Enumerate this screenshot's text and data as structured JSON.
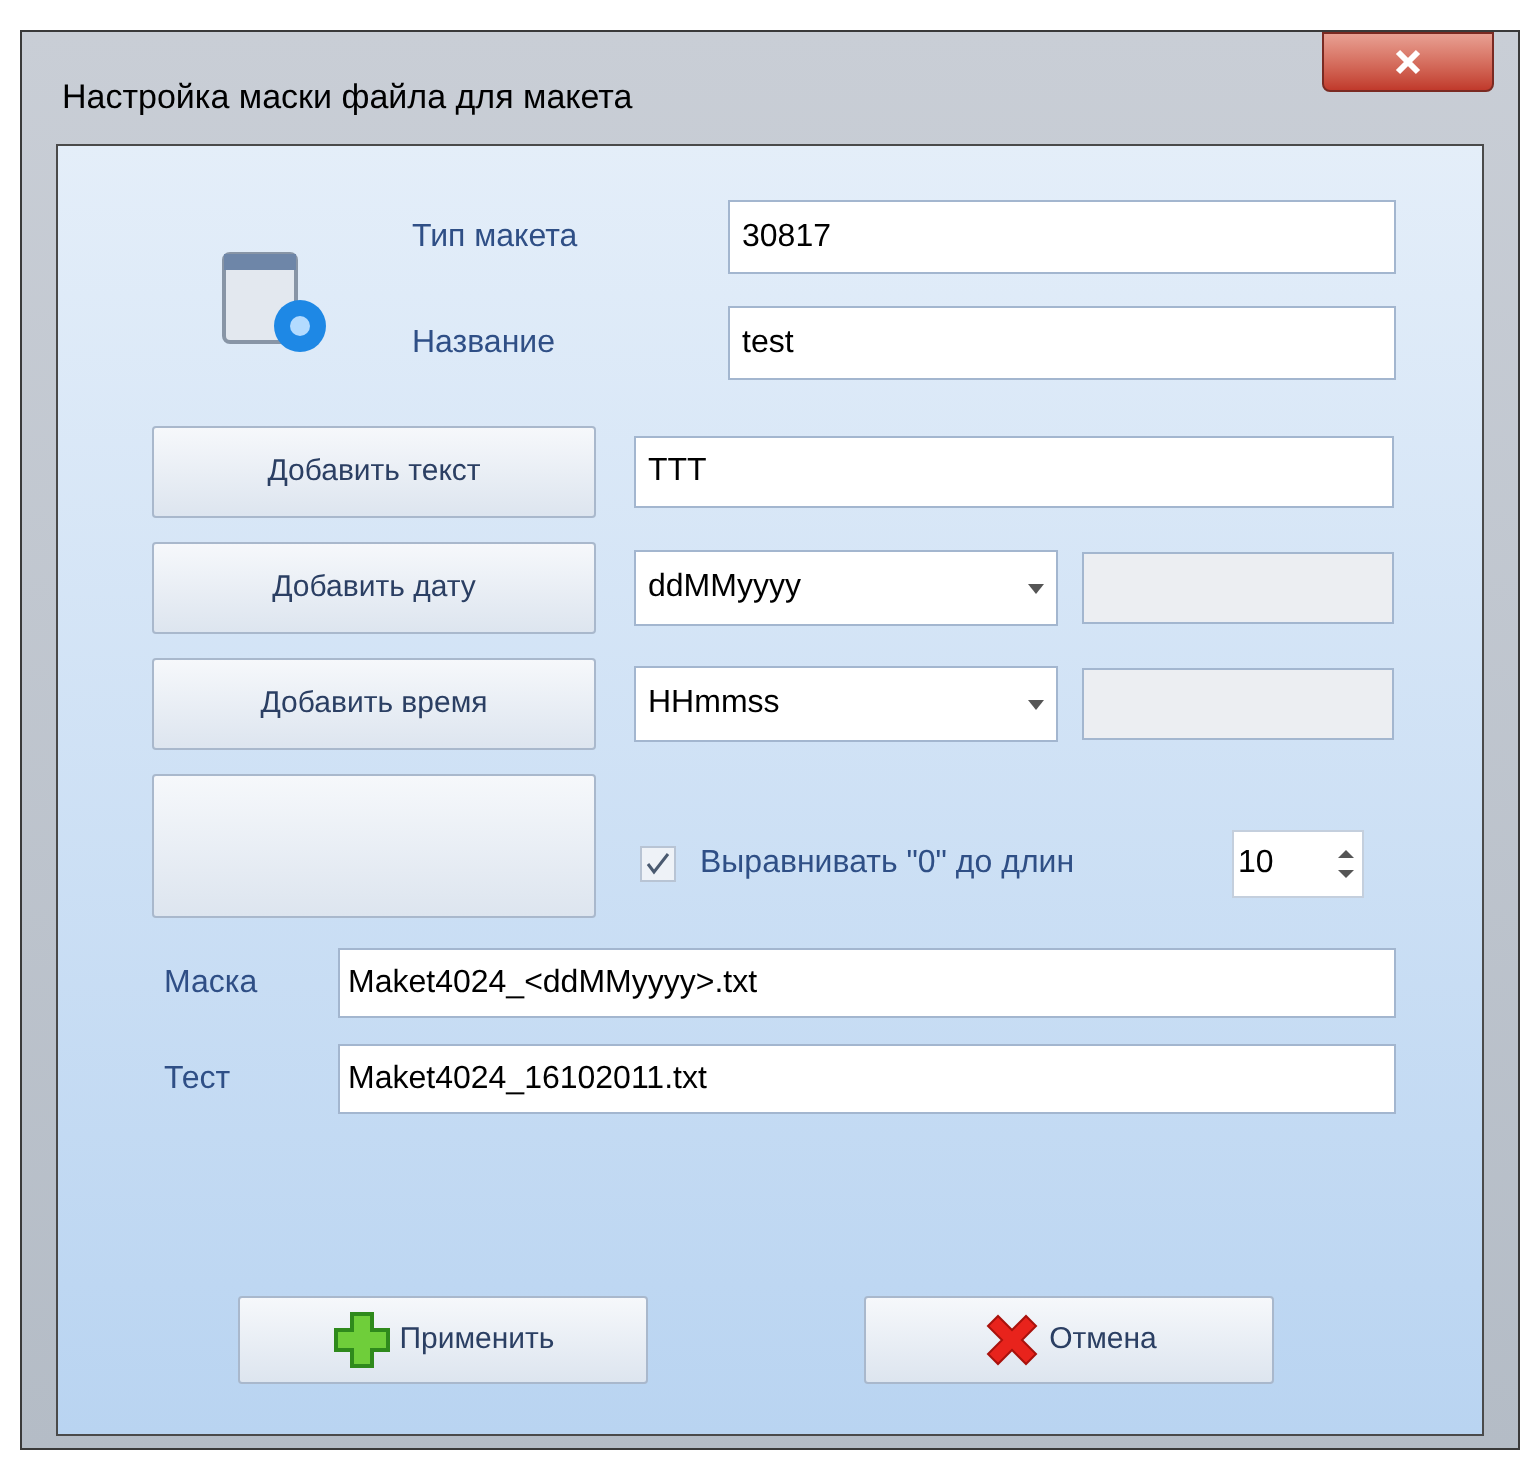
{
  "window": {
    "title": "Настройка маски файла для макета"
  },
  "header_fields": [
    {
      "label": "Тип макета",
      "value": "30817"
    },
    {
      "label": "Название",
      "value": "test"
    }
  ],
  "add_text": {
    "button": "Добавить текст",
    "value": "TTT"
  },
  "add_rows": [
    {
      "button": "Добавить дату",
      "value": "ddMMyyyy",
      "extra_disabled": true
    },
    {
      "button": "Добавить время",
      "value": "HHmmss",
      "extra_disabled": true
    }
  ],
  "pad_zero": {
    "label": "Выравнивать \"0\" до длин",
    "checked": true,
    "length": "10"
  },
  "mask": {
    "label": "Маска",
    "value": "Maket4024_<ddMMyyyy>.txt"
  },
  "test": {
    "label": "Тест",
    "value": "Maket4024_16102011.txt"
  },
  "buttons": [
    {
      "kind": "apply",
      "label": "Применить"
    },
    {
      "kind": "cancel",
      "label": "Отмена"
    }
  ]
}
